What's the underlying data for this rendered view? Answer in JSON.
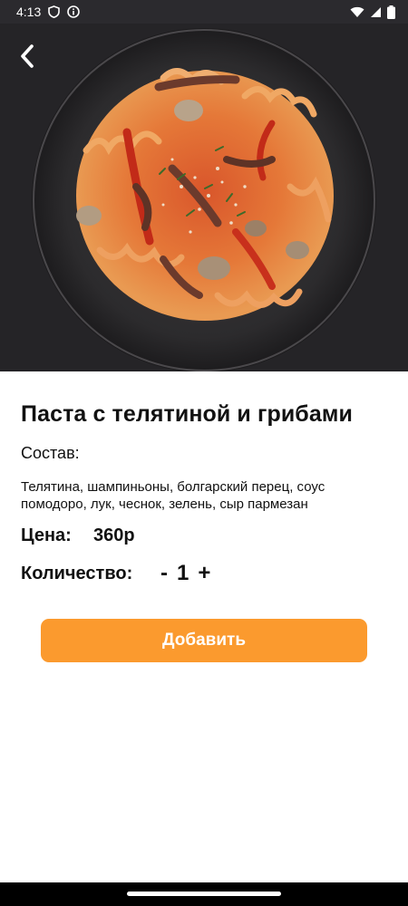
{
  "status_bar": {
    "time": "4:13",
    "icons": [
      "shield-icon",
      "info-icon",
      "wifi-icon",
      "signal-icon",
      "battery-icon"
    ],
    "background": "#2b2a2e"
  },
  "hero": {
    "image": "pasta-dish-photo",
    "back_icon": "chevron-left-icon"
  },
  "product": {
    "title": "Паста с телятиной и грибами",
    "composition_label": "Состав:",
    "ingredients": "Телятина, шампиньоны, болгарский перец, соус помодоро, лук, чеснок, зелень, сыр пармезан",
    "price_label": "Цена:",
    "price_value": "360р",
    "quantity_label": "Количество:",
    "quantity_minus": "-",
    "quantity_value": "1",
    "quantity_plus": "+"
  },
  "actions": {
    "add_label": "Добавить",
    "accent_color": "#fb9a2e"
  }
}
